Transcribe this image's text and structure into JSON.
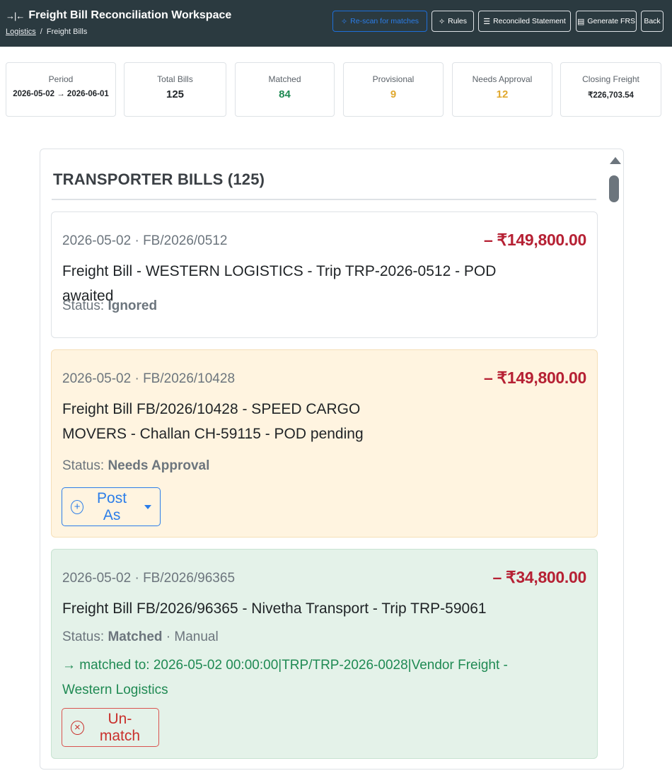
{
  "header": {
    "title": "Freight Bill Reconciliation Workspace",
    "title_icon": "split-arrows-icon",
    "breadcrumb": [
      "Logistics",
      "Freight Bills"
    ],
    "buttons": {
      "rescan": "Re-scan for matches",
      "rules": "Rules",
      "reconciled": "Reconciled Statement",
      "frs": "Generate FRS",
      "back": "Back"
    }
  },
  "stats": {
    "period": {
      "label": "Period",
      "value": "2026-05-02 → 2026-06-01"
    },
    "total": {
      "label": "Total Bills",
      "value": "125"
    },
    "matched": {
      "label": "Matched",
      "value": "84"
    },
    "provisional": {
      "label": "Provisional",
      "value": "9"
    },
    "approval": {
      "label": "Needs Approval",
      "value": "12"
    },
    "closing": {
      "label": "Closing Freight",
      "value": "₹226,703.54"
    }
  },
  "panel": {
    "title": "TRANSPORTER BILLS (125)",
    "bills": [
      {
        "meta": "2026-05-02 · FB/2026/0512",
        "amount": "– ₹149,800.00",
        "description": "Freight Bill - WESTERN LOGISTICS - Trip TRP-2026-0512 - POD awaited",
        "status_label": "Status:",
        "status": "Ignored"
      },
      {
        "meta": "2026-05-02 · FB/2026/10428",
        "amount": "– ₹149,800.00",
        "description": "Freight Bill FB/2026/10428 - SPEED CARGO MOVERS - Challan CH-59115 - POD pending",
        "status_label": "Status:",
        "status": "Needs Approval",
        "action": "Post As"
      },
      {
        "meta": "2026-05-02 · FB/2026/96365",
        "amount": "– ₹34,800.00",
        "description": "Freight Bill FB/2026/96365 - Nivetha Transport - Trip TRP-59061",
        "status_label": "Status:",
        "status": "Matched",
        "status_extra": " · Manual",
        "matched_to": "→ matched to: 2026-05-02 00:00:00|TRP/TRP-2026-0028|Vendor Freight - Western Logistics",
        "action": "Un-match"
      }
    ]
  },
  "colors": {
    "header_bg": "#2b3a40",
    "debit": "#b62134",
    "matched": "#1f8a53",
    "warning": "#e0a82e",
    "primary": "#2b7de9"
  }
}
